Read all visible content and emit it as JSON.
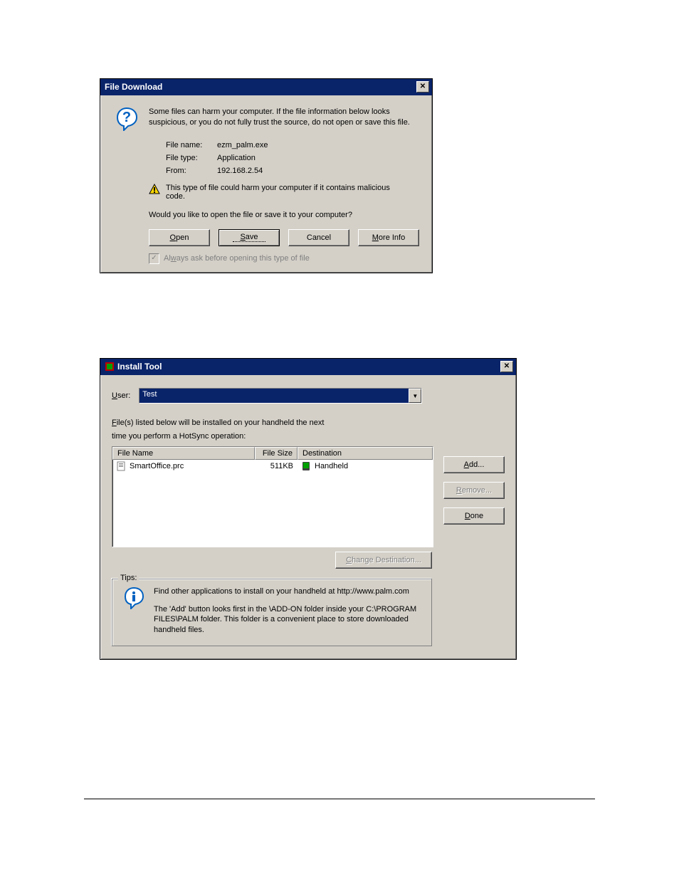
{
  "dlg1": {
    "title": "File Download",
    "message": "Some files can harm your computer. If the file information below looks suspicious, or you do not fully trust the source, do not open or save this file.",
    "fields": {
      "filename_label": "File name:",
      "filename_value": "ezm_palm.exe",
      "filetype_label": "File type:",
      "filetype_value": "Application",
      "from_label": "From:",
      "from_value": "192.168.2.54"
    },
    "warning": "This type of file could harm your computer if it contains malicious code.",
    "question": "Would you like to open the file or save it to your computer?",
    "buttons": {
      "open": "Open",
      "save": "Save",
      "cancel": "Cancel",
      "moreinfo": "More Info"
    },
    "checkbox_label": "Always ask before opening this type of file"
  },
  "dlg2": {
    "title": "Install Tool",
    "user_label": "User:",
    "user_value": "Test",
    "instruction": "File(s) listed below will be installed on your handheld the next time you perform a HotSync operation:",
    "columns": {
      "name": "File Name",
      "size": "File Size",
      "dest": "Destination"
    },
    "rows": [
      {
        "name": "SmartOffice.prc",
        "size": "511KB",
        "dest": "Handheld"
      }
    ],
    "change_dest": "Change Destination...",
    "buttons": {
      "add": "Add...",
      "remove": "Remove...",
      "done": "Done"
    },
    "tips": {
      "legend": "Tips:",
      "line1": "Find other applications to install on your handheld at http://www.palm.com",
      "line2": "The 'Add' button looks first in the \\ADD-ON folder inside your C:\\PROGRAM FILES\\PALM folder. This folder is a convenient place to store downloaded handheld files."
    }
  }
}
